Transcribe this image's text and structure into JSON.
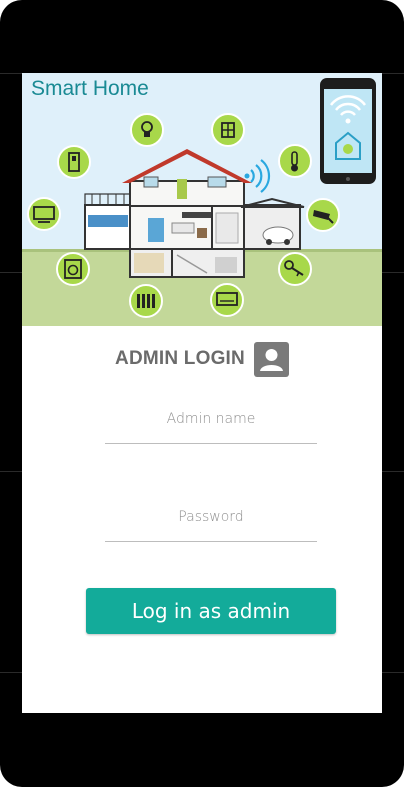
{
  "hero": {
    "title": "Smart Home",
    "illustration": "smart-home-house-illustration",
    "icons": [
      "lightbulb-icon",
      "window-icon",
      "thermometer-icon",
      "light-switch-icon",
      "tv-icon",
      "security-camera-icon",
      "washing-machine-icon",
      "key-icon",
      "radiator-icon",
      "air-conditioner-icon",
      "wifi-icon",
      "smartphone-icon"
    ],
    "colors": {
      "sky": "#dff0fa",
      "grass": "#c3d899",
      "icon_green": "#a8d84a",
      "title": "#1a8a94"
    }
  },
  "login": {
    "title": "ADMIN LOGIN",
    "admin_icon": "admin-user-icon",
    "name_placeholder": "Admin name",
    "password_placeholder": "Password",
    "button_label": "Log in as admin",
    "button_color": "#13ab9a"
  }
}
